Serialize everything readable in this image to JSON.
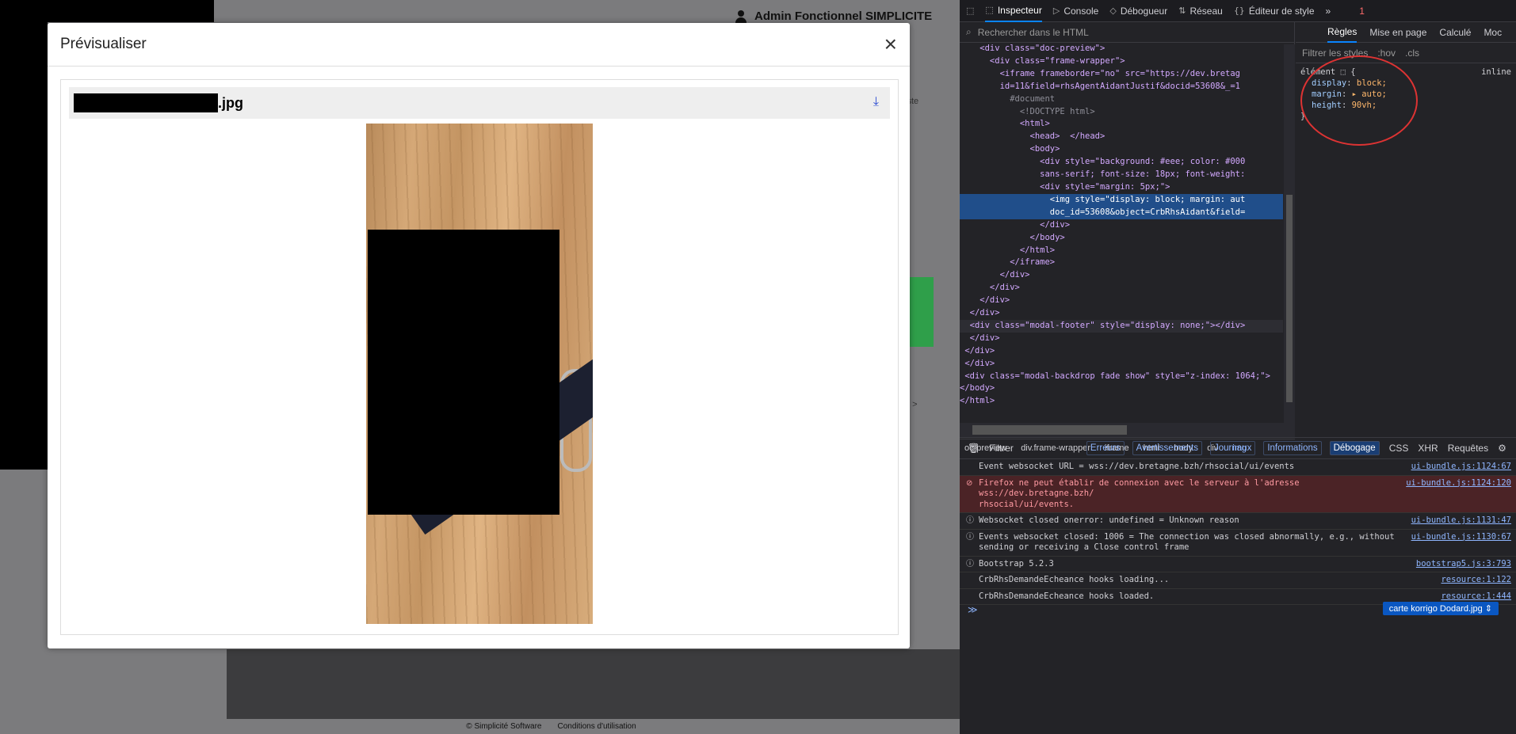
{
  "background_app": {
    "user_name": "Admin Fonctionnel SIMPLICITE",
    "right_fragment_1": "iste",
    "right_fragment_2": "e >",
    "footer_copyright": "© Simplicité Software",
    "footer_terms": "Conditions d'utilisation"
  },
  "modal": {
    "title": "Prévisualiser",
    "close_glyph": "×",
    "file_suffix": ".jpg",
    "download_glyph": "⤓"
  },
  "devtools": {
    "tabs": [
      {
        "label": "Inspecteur",
        "glyph": "⬚"
      },
      {
        "label": "Console",
        "glyph": "▷"
      },
      {
        "label": "Débogueur",
        "glyph": "◇"
      },
      {
        "label": "Réseau",
        "glyph": "⇅"
      },
      {
        "label": "Éditeur de style",
        "glyph": "{}"
      }
    ],
    "more_glyph": "»",
    "error_count": "1",
    "html_search_placeholder": "Rechercher dans le HTML",
    "html_tree": [
      "    <div class=\"doc-preview\">",
      "      <div class=\"frame-wrapper\">",
      "        <iframe frameborder=\"no\" src=\"https://dev.bretag",
      "        id=11&field=rhsAgentAidantJustif&docid=53608&_=1",
      "          #document",
      "            <!DOCTYPE html>",
      "            <html>",
      "              <head>  </head>",
      "              <body>",
      "                <div style=\"background: #eee; color: #000",
      "                sans-serif; font-size: 18px; font-weight:",
      "                <div style=\"margin: 5px;\">",
      "                  <img style=\"display: block; margin: aut",
      "                  doc_id=53608&object=CrbRhsAidant&field=",
      "                </div>",
      "              </body>",
      "            </html>",
      "          </iframe>",
      "        </div>",
      "      </div>",
      "    </div>",
      "  </div>",
      "  <div class=\"modal-footer\" style=\"display: none;\"></div>",
      "  </div>",
      " </div>",
      " </div>",
      " <div class=\"modal-backdrop fade show\" style=\"z-index: 1064;\">",
      "</body>",
      "</html>"
    ],
    "breadcrumb": [
      "oc-preview",
      "div.frame-wrapper",
      "iframe",
      "html",
      "body",
      "div",
      "img"
    ],
    "rules_tabs": [
      "Règles",
      "Mise en page",
      "Calculé",
      "Moc"
    ],
    "rules_filter_placeholder": "Filtrer les styles",
    "rules_filter_btns": [
      ":hov",
      ".cls"
    ],
    "rule_selector": "élément ⬚ {",
    "rule_inline": "inline",
    "rule_props": [
      {
        "prop": "display",
        "value": "block;"
      },
      {
        "prop": "margin",
        "value": "▸ auto;"
      },
      {
        "prop": "height",
        "value": "90vh;"
      }
    ],
    "rule_close": "}",
    "console_filter_placeholder": "Filtrer",
    "console_levels": [
      "Erreurs",
      "Avertissements",
      "Journaux",
      "Informations",
      "Débogage"
    ],
    "console_types": [
      "CSS",
      "XHR",
      "Requêtes"
    ],
    "console_logs": [
      {
        "type": "log",
        "msg": "Event websocket URL = wss://dev.bretagne.bzh/rhsocial/ui/events",
        "src": "ui-bundle.js:1124:67"
      },
      {
        "type": "error",
        "msg": "Firefox ne peut établir de connexion avec le serveur à l'adresse wss://dev.bretagne.bzh/\nrhsocial/ui/events.",
        "src": "ui-bundle.js:1124:120"
      },
      {
        "type": "info",
        "msg": "Websocket closed onerror: undefined = Unknown reason",
        "src": "ui-bundle.js:1131:47"
      },
      {
        "type": "info",
        "msg": "Events websocket closed: 1006 = The connection was closed abnormally, e.g., without\nsending or receiving a Close control frame",
        "src": "ui-bundle.js:1130:67"
      },
      {
        "type": "info",
        "msg": "Bootstrap 5.2.3",
        "src": "bootstrap5.js:3:793"
      },
      {
        "type": "log",
        "msg": "CrbRhsDemandeEcheance hooks loading...",
        "src": "resource:1:122"
      },
      {
        "type": "log",
        "msg": "CrbRhsDemandeEcheance hooks loaded.",
        "src": "resource:1:444"
      }
    ],
    "console_prompt": "≫",
    "context_select": "carte korrigo Dodard.jpg ⇕"
  }
}
